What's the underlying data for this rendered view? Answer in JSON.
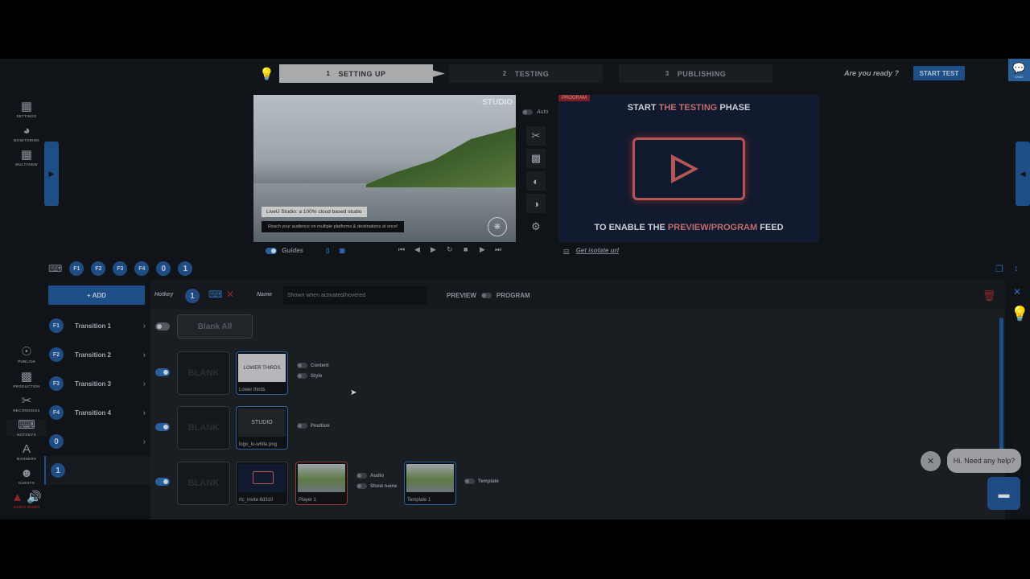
{
  "steps": [
    {
      "num": "1",
      "label": "SETTING UP"
    },
    {
      "num": "2",
      "label": "TESTING"
    },
    {
      "num": "3",
      "label": "PUBLISHING"
    }
  ],
  "header": {
    "ready_text": "Are you ready ?",
    "start_test": "START TEST",
    "chat_label": "CHAT"
  },
  "rail_top": [
    "SETTINGS",
    "MONITORING",
    "MULTIVIEW"
  ],
  "rail_bottom": [
    "PUBLISH",
    "PRODUCTION",
    "RECORDINGS",
    "HOTKEYS",
    "BANNERS",
    "GUESTS",
    "AUDIO MIXER"
  ],
  "preview": {
    "logo": "STUDIO",
    "caption1": "LiveU Studio: a 100% cloud based studio",
    "caption2": "Reach your audience on multiple platforms & destinations at once!"
  },
  "auto_label": "Auto",
  "program": {
    "tag": "PROGRAM",
    "line1_a": "START ",
    "line1_b": "THE TESTING",
    "line1_c": " PHASE",
    "line2_a": "TO ENABLE THE ",
    "line2_b": "PREVIEW/PROGRAM",
    "line2_c": " FEED"
  },
  "guides_label": "Guides",
  "isolate_label": "Get isolate url",
  "hotkeys": [
    "F1",
    "F2",
    "F3",
    "F4",
    "0",
    "1"
  ],
  "add_label": "+ ADD",
  "transitions": [
    {
      "key": "F1",
      "name": "Transition 1"
    },
    {
      "key": "F2",
      "name": "Transition 2"
    },
    {
      "key": "F3",
      "name": "Transition 3"
    },
    {
      "key": "F4",
      "name": "Transition 4"
    },
    {
      "key": "0",
      "name": ""
    },
    {
      "key": "1",
      "name": ""
    }
  ],
  "editor": {
    "hotkey_label": "Hotkey",
    "hotkey_value": "1",
    "name_label": "Name",
    "name_placeholder": "Shown when activated/hovered",
    "preview_label": "PREVIEW",
    "program_label": "PROGRAM",
    "blank_all": "Blank All",
    "blank": "BLANK",
    "cards": {
      "lower_title": "LOWER THIRDS",
      "lower_label": "Lower thirds",
      "logo_title": "STUDIO",
      "logo_label": "logo_lu-white.png",
      "rtc_label": "rtc_invite 6d310",
      "player_label": "Player 1",
      "template_label": "Template 1"
    },
    "options": {
      "content": "Content",
      "style": "Style",
      "position": "Position",
      "audio": "Audio",
      "show_name": "Show name",
      "template": "Template"
    }
  },
  "help": {
    "bubble": "Hi. Need any help?"
  }
}
